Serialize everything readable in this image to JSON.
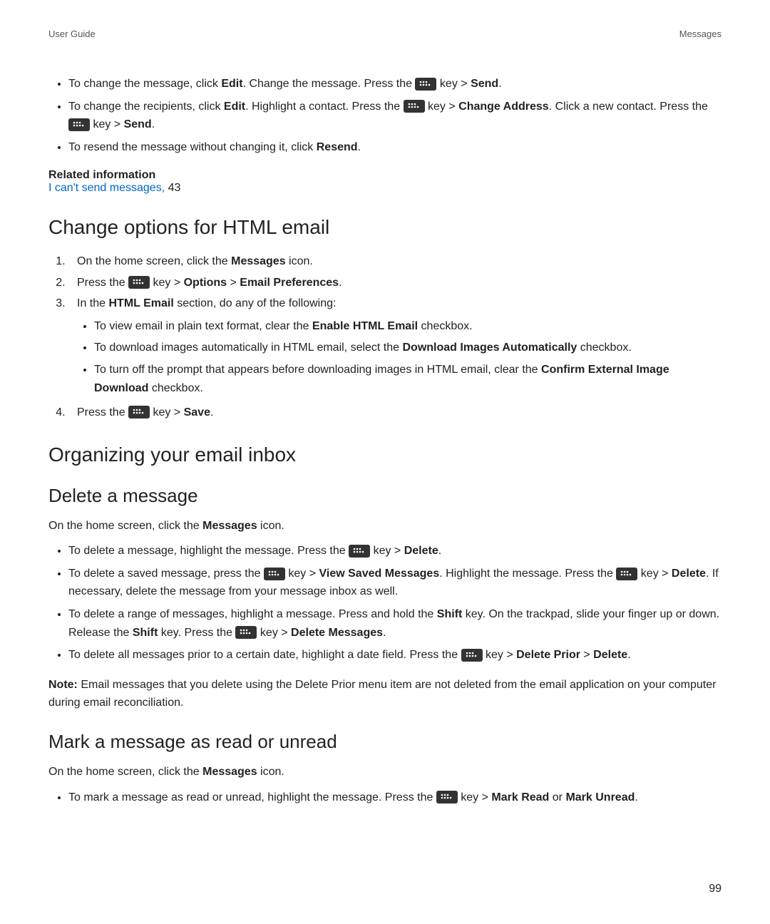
{
  "header": {
    "left": "User Guide",
    "right": "Messages"
  },
  "intro_bullets": {
    "b1": {
      "t1": "To change the message, click ",
      "edit": "Edit",
      "t2": ". Change the message. Press the ",
      "t3": " key > ",
      "send": "Send",
      "t4": "."
    },
    "b2": {
      "t1": "To change the recipients, click ",
      "edit": "Edit",
      "t2": ". Highlight a contact. Press the ",
      "t3": " key > ",
      "chg": "Change Address",
      "t4": ". Click a new contact. Press the ",
      "t5": " key > ",
      "send": "Send",
      "t6": "."
    },
    "b3": {
      "t1": "To resend the message without changing it, click ",
      "resend": "Resend",
      "t2": "."
    }
  },
  "related": {
    "heading": "Related information",
    "link": "I can't send messages,",
    "page": " 43"
  },
  "sec_html": {
    "title": "Change options for HTML email",
    "s1": {
      "t1": "On the home screen, click the ",
      "msgs": "Messages",
      "t2": " icon."
    },
    "s2": {
      "t1": "Press the ",
      "t2": " key > ",
      "opt": "Options",
      "gt": " > ",
      "pref": "Email Preferences",
      "t3": "."
    },
    "s3": {
      "t1": "In the ",
      "he": "HTML Email",
      "t2": " section, do any of the following:"
    },
    "s3a": {
      "t1": "To view email in plain text format, clear the ",
      "b": "Enable HTML Email",
      "t2": " checkbox."
    },
    "s3b": {
      "t1": "To download images automatically in HTML email, select the ",
      "b": "Download Images Automatically",
      "t2": " checkbox."
    },
    "s3c": {
      "t1": "To turn off the prompt that appears before downloading images in HTML email, clear the ",
      "b": "Confirm External Image Download",
      "t2": " checkbox."
    },
    "s4": {
      "t1": "Press the ",
      "t2": " key > ",
      "save": "Save",
      "t3": "."
    }
  },
  "sec_org": {
    "title": "Organizing your email inbox"
  },
  "sec_delete": {
    "title": "Delete a message",
    "intro": {
      "t1": "On the home screen, click the ",
      "msgs": "Messages",
      "t2": " icon."
    },
    "b1": {
      "t1": "To delete a message, highlight the message. Press the ",
      "t2": " key > ",
      "del": "Delete",
      "t3": "."
    },
    "b2": {
      "t1": "To delete a saved message, press the ",
      "t2": " key > ",
      "vsm": "View Saved Messages",
      "t3": ". Highlight the message. Press the ",
      "t4": " key > ",
      "del": "Delete",
      "t5": ". If necessary, delete the message from your message inbox as well."
    },
    "b3": {
      "t1": "To delete a range of messages, highlight a message. Press and hold the ",
      "shift1": "Shift",
      "t2": " key. On the trackpad, slide your finger up or down. Release the ",
      "shift2": "Shift",
      "t3": " key. Press the ",
      "t4": " key > ",
      "dm": "Delete Messages",
      "t5": "."
    },
    "b4": {
      "t1": "To delete all messages prior to a certain date, highlight a date field. Press the ",
      "t2": " key > ",
      "dp": "Delete Prior",
      "gt": " > ",
      "del": "Delete",
      "t3": "."
    },
    "note": {
      "label": "Note:",
      "text": " Email messages that you delete using the Delete Prior menu item are not deleted from the email application on your computer during email reconciliation."
    }
  },
  "sec_mark": {
    "title": "Mark a message as read or unread",
    "intro": {
      "t1": "On the home screen, click the ",
      "msgs": "Messages",
      "t2": " icon."
    },
    "b1": {
      "t1": "To mark a message as read or unread, highlight the message. Press the ",
      "t2": " key > ",
      "mr": "Mark Read",
      "or": " or ",
      "mu": "Mark Unread",
      "t3": "."
    }
  },
  "page_number": "99"
}
